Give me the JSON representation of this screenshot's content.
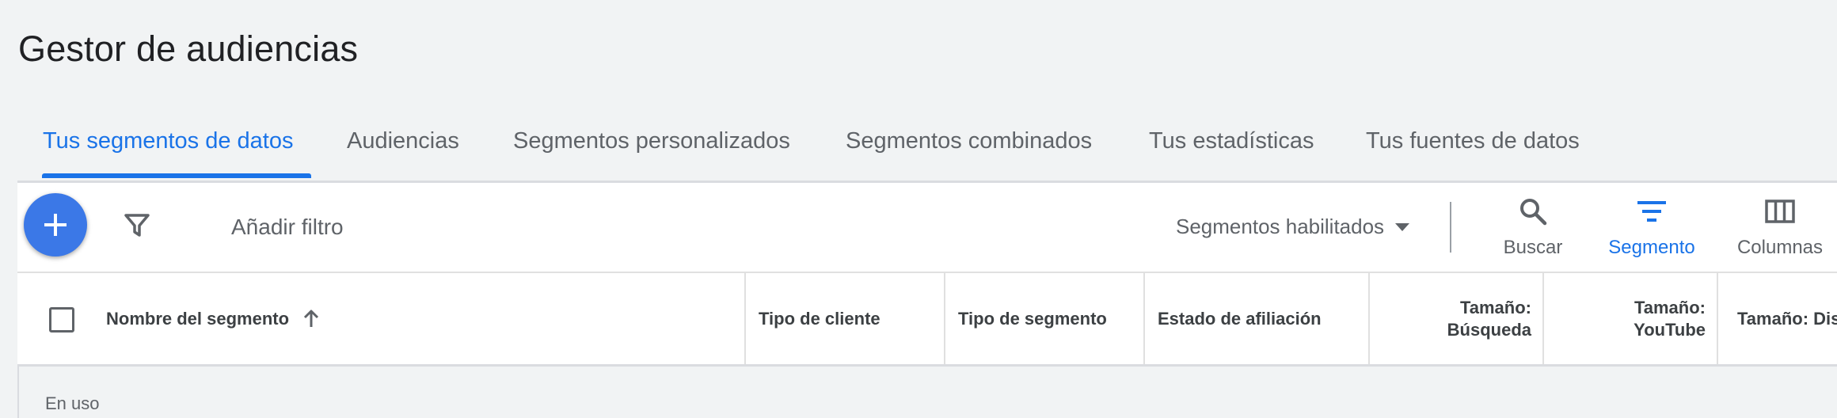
{
  "page": {
    "title": "Gestor de audiencias"
  },
  "tabs": [
    {
      "label": "Tus segmentos de datos",
      "active": true
    },
    {
      "label": "Audiencias"
    },
    {
      "label": "Segmentos personalizados"
    },
    {
      "label": "Segmentos combinados"
    },
    {
      "label": "Tus estadísticas"
    },
    {
      "label": "Tus fuentes de datos"
    }
  ],
  "toolbar": {
    "add_filter": "Añadir filtro",
    "segment_filter": "Segmentos habilitados",
    "tools": [
      {
        "label": "Buscar",
        "icon": "search-icon"
      },
      {
        "label": "Segmento",
        "icon": "segment-icon",
        "active": true
      },
      {
        "label": "Columnas",
        "icon": "columns-icon"
      }
    ]
  },
  "table": {
    "columns": [
      "Nombre del segmento",
      "Tipo de cliente",
      "Tipo de segmento",
      "Estado de afiliación",
      "Tamaño:\nBúsqueda",
      "Tamaño:\nYouTube",
      "Tamaño: Display"
    ],
    "sort_icon": "arrow-up-icon",
    "section_label": "En uso"
  },
  "colors": {
    "accent": "#1a73e8",
    "fab": "#3b78e7",
    "background": "#f1f3f4"
  }
}
